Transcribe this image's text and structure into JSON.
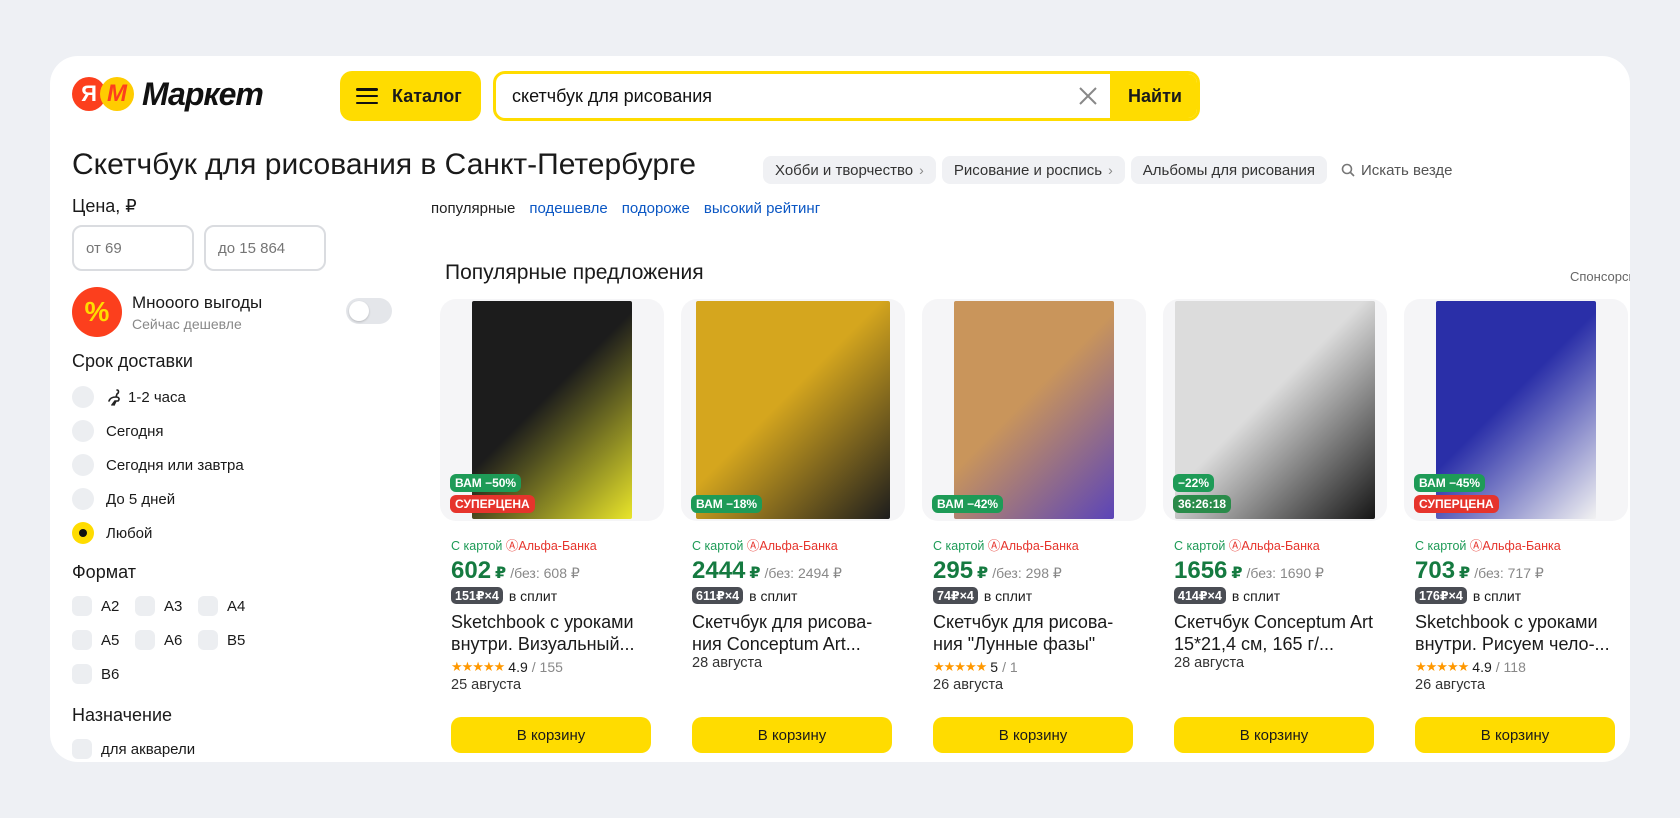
{
  "header": {
    "logo_ya": "Я",
    "logo_m": "M",
    "logo_word": "Маркет",
    "catalog_label": "Каталог",
    "search_value": "скетчбук для рисования",
    "search_button": "Найти"
  },
  "title": {
    "text": "Скетчбук для рисования в Санкт-Петербурге",
    "crumbs": [
      "Хобби и творчество",
      "Рисование и роспись",
      "Альбомы для рисования"
    ],
    "search_anywhere": "Искать везде"
  },
  "sidebar": {
    "price_title": "Цена, ₽",
    "price_from_placeholder": "от 69",
    "price_to_placeholder": "до 15 864",
    "promo_badge": "%",
    "promo_title": "Мнооого выгоды",
    "promo_sub": "Сейчас дешевле",
    "delivery_title": "Срок доставки",
    "delivery_options": [
      "1-2 часа",
      "Сегодня",
      "Сегодня или завтра",
      "До 5 дней",
      "Любой"
    ],
    "format_title": "Формат",
    "formats": [
      "A2",
      "A3",
      "A4",
      "A5",
      "A6",
      "B5",
      "B6"
    ],
    "purpose_title": "Назначение",
    "purpose_options": [
      "для акварели"
    ]
  },
  "sorts": [
    "популярные",
    "подешевле",
    "подороже",
    "высокий рейтинг"
  ],
  "section": {
    "title": "Популярные предложения",
    "sponsor": "Спонсорские"
  },
  "card_prefix": "С картой",
  "card_bank": "Альфа-Банка",
  "split_suffix": "в сплит",
  "buy_label": "В корзину",
  "products": [
    {
      "badges": [
        "ВАМ −50%",
        "СУПЕРЦЕНА"
      ],
      "price": "602",
      "old": "/без: 608 ₽",
      "split": "151₽×4",
      "name": "Sketchbook с уроками внутри. Визуальный...",
      "stars": "★★★★★",
      "rating": "4.9",
      "reviews": "/ 155",
      "date": "25 августа",
      "art_colors": [
        "#1c1c1c",
        "#e9e52a"
      ]
    },
    {
      "badges": [
        "ВАМ −18%"
      ],
      "price": "2444",
      "old": "/без: 2494 ₽",
      "split": "611₽×4",
      "name": "Скетчбук для рисова-ния Conceptum Art...",
      "stars": "",
      "rating": "",
      "reviews": "",
      "date": "28 августа",
      "art_colors": [
        "#d5a61e",
        "#1d1d1d"
      ]
    },
    {
      "badges": [
        "ВАМ −42%"
      ],
      "price": "295",
      "old": "/без: 298 ₽",
      "split": "74₽×4",
      "name": "Скетчбук для рисова-ния \"Лунные фазы\"",
      "stars": "★★★★★",
      "rating": "5",
      "reviews": "/ 1",
      "date": "26 августа",
      "art_colors": [
        "#c9955b",
        "#5b44b8"
      ]
    },
    {
      "badges": [
        "−22%",
        "36:26:18"
      ],
      "price": "1656",
      "old": "/без: 1690 ₽",
      "split": "414₽×4",
      "name": "Скетчбук Conceptum Art 15*21,4 см, 165 г/...",
      "stars": "",
      "rating": "",
      "reviews": "",
      "date": "28 августа",
      "art_colors": [
        "#dcdcdc",
        "#151515"
      ]
    },
    {
      "badges": [
        "ВАМ −45%",
        "СУПЕРЦЕНА"
      ],
      "price": "703",
      "old": "/без: 717 ₽",
      "split": "176₽×4",
      "name": "Sketchbook с уроками внутри. Рисуем чело-...",
      "stars": "★★★★★",
      "rating": "4.9",
      "reviews": "/ 118",
      "date": "26 августа",
      "art_colors": [
        "#2a2fa8",
        "#f2f2f2"
      ]
    }
  ]
}
